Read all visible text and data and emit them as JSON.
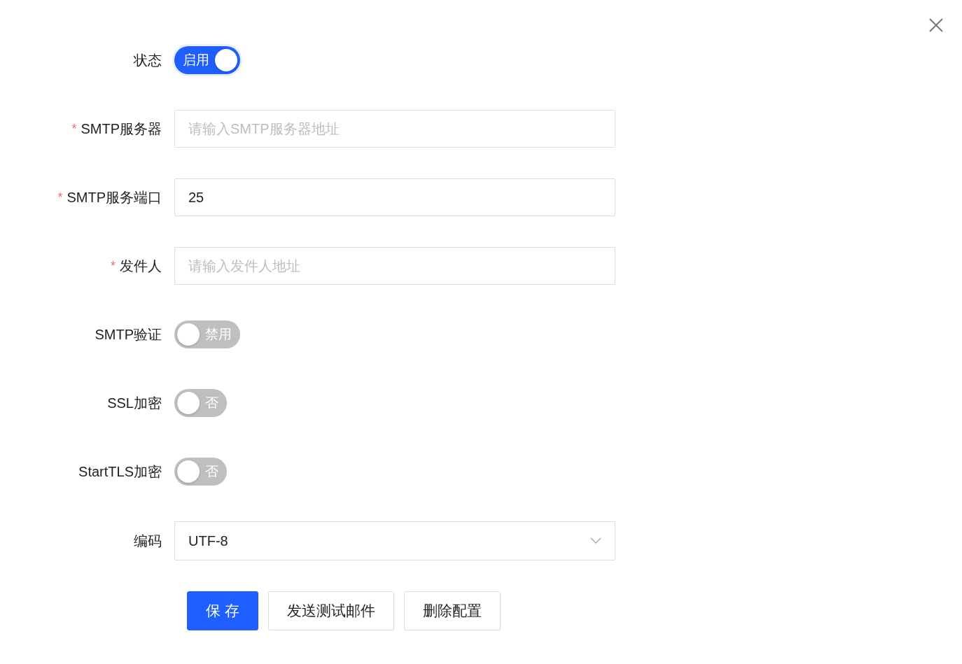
{
  "fields": [
    {
      "kind": "switch",
      "label": "状态",
      "required": false,
      "on": true,
      "text": "启用"
    },
    {
      "kind": "input",
      "label": "SMTP服务器",
      "required": true,
      "placeholder": "请输入SMTP服务器地址"
    },
    {
      "kind": "input",
      "label": "SMTP服务端口",
      "required": true,
      "value": "25"
    },
    {
      "kind": "input",
      "label": "发件人",
      "required": true,
      "placeholder": "请输入发件人地址"
    },
    {
      "kind": "switch",
      "label": "SMTP验证",
      "required": false,
      "on": false,
      "text": "禁用"
    },
    {
      "kind": "switch",
      "label": "SSL加密",
      "required": false,
      "on": false,
      "text": "否"
    },
    {
      "kind": "switch",
      "label": "StartTLS加密",
      "required": false,
      "on": false,
      "text": "否"
    },
    {
      "kind": "select",
      "label": "编码",
      "required": false,
      "value": "UTF-8"
    }
  ],
  "required_mark": "*",
  "buttons": [
    {
      "kind": "primary",
      "label": "保 存"
    },
    {
      "kind": "default",
      "label": "发送测试邮件"
    },
    {
      "kind": "default",
      "label": "删除配置"
    }
  ]
}
